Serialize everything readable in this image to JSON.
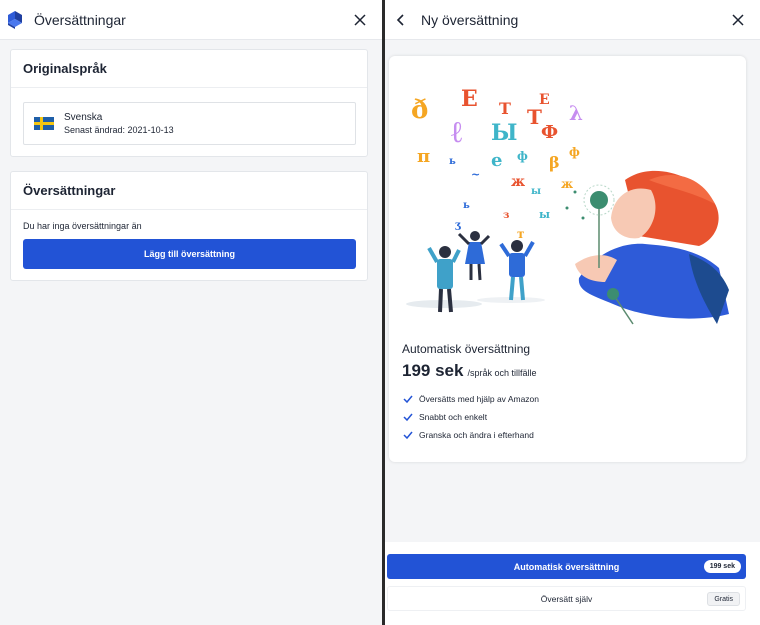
{
  "left": {
    "title": "Översättningar",
    "original_card": {
      "title": "Originalspråk",
      "language": {
        "name": "Svenska",
        "last_modified": "Senast ändrad: 2021-10-13",
        "flag": "sweden-flag"
      }
    },
    "translations_card": {
      "title": "Översättningar",
      "empty_text": "Du har inga översättningar än",
      "add_button": "Lägg till översättning"
    }
  },
  "right": {
    "title": "Ny översättning",
    "offer": {
      "title": "Automatisk översättning",
      "price": "199 sek",
      "price_unit": "/språk och tillfälle",
      "features": [
        "Översätts med hjälp av Amazon",
        "Snabbt och enkelt",
        "Granska och ändra i efterhand"
      ]
    },
    "footer": {
      "auto_button": {
        "label": "Automatisk översättning",
        "badge": "199 sek"
      },
      "self_button": {
        "label": "Översätt själv",
        "badge": "Gratis"
      }
    }
  },
  "colors": {
    "primary": "#2253d6",
    "background": "#f4f5f7",
    "text": "#1d2433",
    "accent_orange": "#e8532f"
  },
  "icons": {
    "logo": "app-logo-icon",
    "close": "close-icon",
    "back": "chevron-left-icon",
    "check": "check-icon"
  }
}
